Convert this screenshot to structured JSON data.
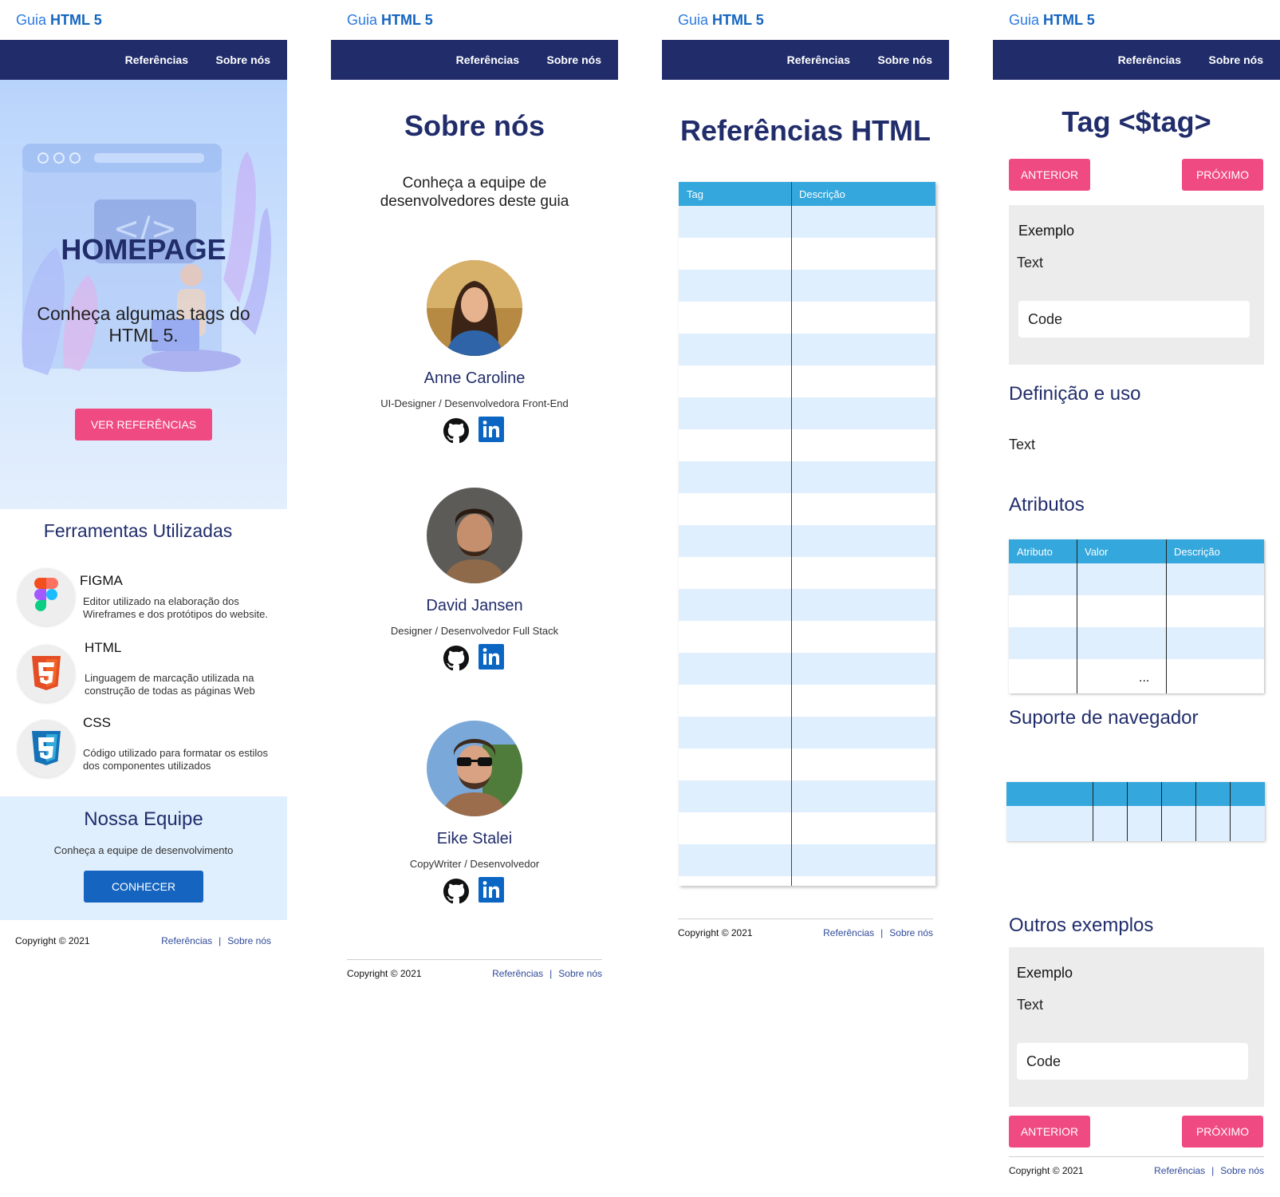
{
  "header": {
    "brand_prefix": "Guia",
    "brand_bold": "HTML 5",
    "nav_references": "Referências",
    "nav_about": "Sobre nós"
  },
  "footer": {
    "copyright": "Copyright © 2021",
    "link_references": "Referências",
    "separator": "|",
    "link_about": "Sobre nós"
  },
  "homepage": {
    "hero_title": "HOMEPAGE",
    "hero_subtitle": "Conheça algumas tags do HTML 5.",
    "hero_button": "VER REFERÊNCIAS",
    "tools_title": "Ferramentas Utilizadas",
    "tools": [
      {
        "name": "FIGMA",
        "description": "Editor utilizado na elaboração dos Wireframes e dos protótipos do website.",
        "icon": "figma-icon"
      },
      {
        "name": "HTML",
        "description": "Linguagem de marcação utilizada na construção de todas as páginas Web",
        "icon": "html5-icon"
      },
      {
        "name": "CSS",
        "description": "Código utilizado para formatar os estilos dos componentes utilizados",
        "icon": "css3-icon"
      }
    ],
    "team_title": "Nossa Equipe",
    "team_subtitle": "Conheça a equipe de desenvolvimento",
    "team_button": "CONHECER"
  },
  "about": {
    "title": "Sobre nós",
    "subtitle": "Conheça a equipe de desenvolvedores deste guia",
    "members": [
      {
        "name": "Anne Caroline",
        "role": "UI-Designer / Desenvolvedora Front-End"
      },
      {
        "name": "David Jansen",
        "role": "Designer / Desenvolvedor Full Stack"
      },
      {
        "name": "Eike Stalei",
        "role": "CopyWriter / Desenvolvedor"
      }
    ]
  },
  "references": {
    "title": "Referências HTML",
    "col_tag": "Tag",
    "col_description": "Descrição"
  },
  "tag_page": {
    "title": "Tag <$tag>",
    "btn_previous": "ANTERIOR",
    "btn_next": "PRÓXIMO",
    "example_label": "Exemplo",
    "example_text": "Text",
    "example_code": "Code",
    "definition_title": "Definição e uso",
    "definition_text": "Text",
    "attributes_title": "Atributos",
    "attr_col_attribute": "Atributo",
    "attr_col_value": "Valor",
    "attr_col_description": "Descrição",
    "attr_more": "...",
    "browser_support_title": "Suporte de navegador",
    "other_examples_title": "Outros exemplos"
  },
  "colors": {
    "navbar": "#212d6b",
    "accent_pink": "#ef4a82",
    "accent_blue": "#1565c0",
    "table_header": "#34a7dc",
    "table_stripe": "#e0effd"
  }
}
